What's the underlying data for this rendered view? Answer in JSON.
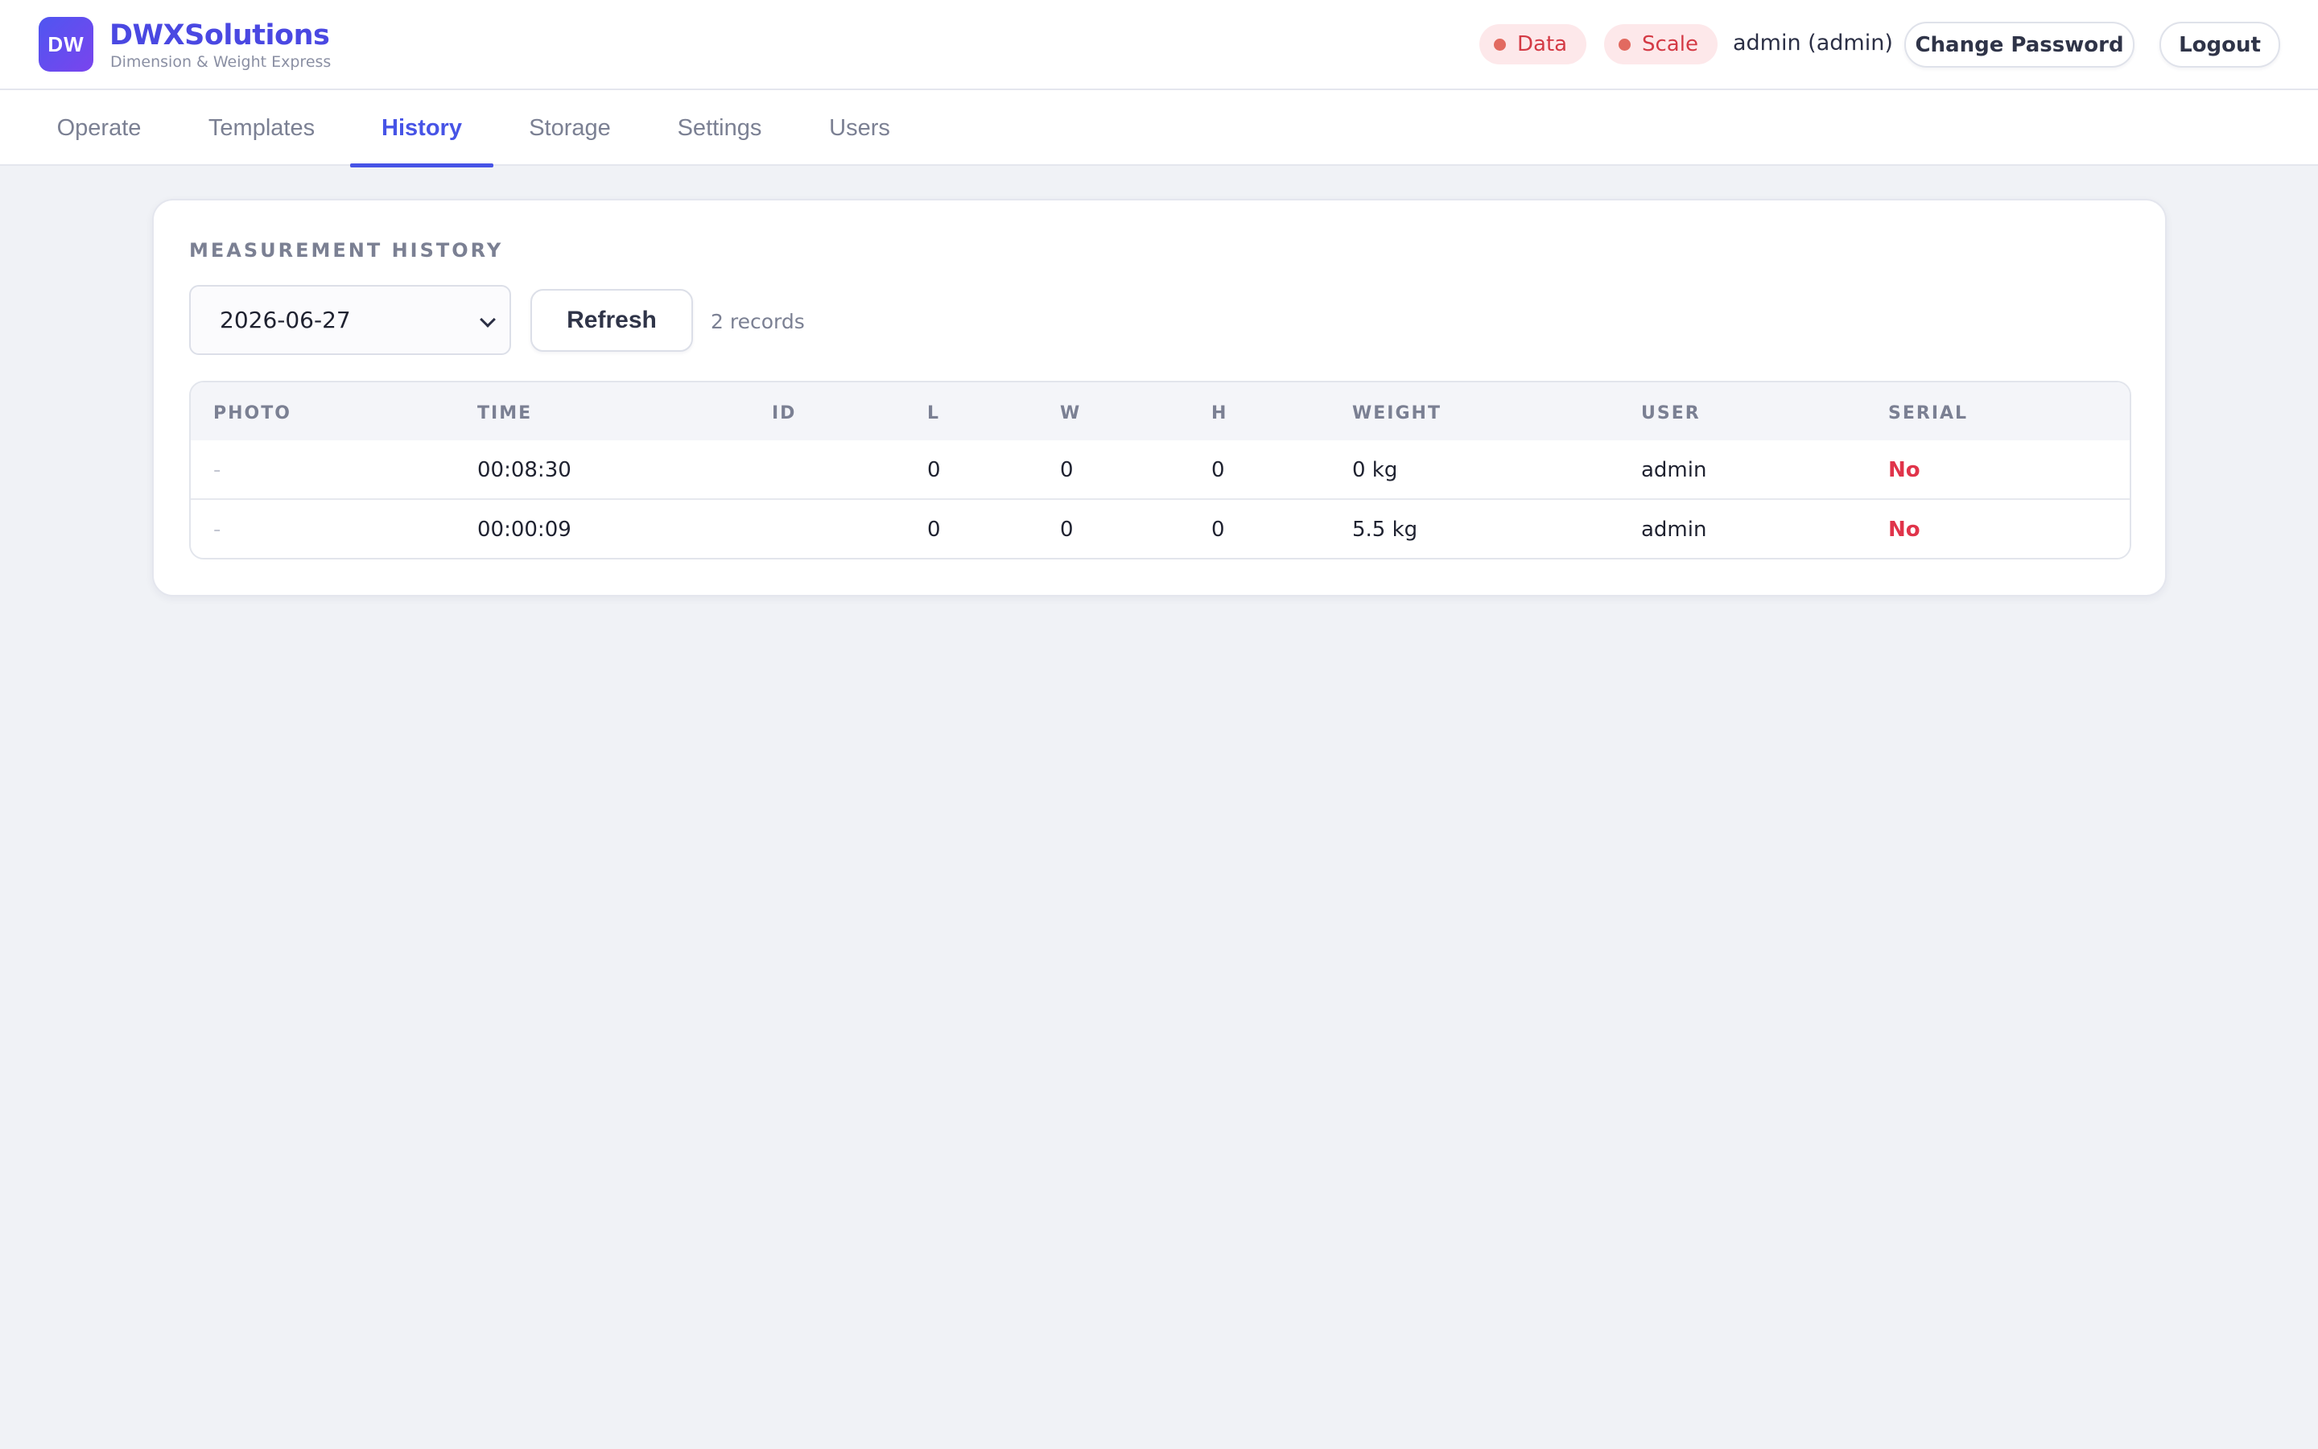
{
  "header": {
    "logo_initials": "DW",
    "brand_name": "DWXSolutions",
    "brand_subtitle": "Dimension & Weight Express",
    "status_pills": [
      {
        "label": "Data",
        "dot_color": "#e26a60"
      },
      {
        "label": "Scale",
        "dot_color": "#e26a60"
      }
    ],
    "user_label": "admin (admin)",
    "change_password_label": "Change Password",
    "logout_label": "Logout"
  },
  "tabs": [
    {
      "label": "Operate",
      "active": false
    },
    {
      "label": "Templates",
      "active": false
    },
    {
      "label": "History",
      "active": true
    },
    {
      "label": "Storage",
      "active": false
    },
    {
      "label": "Settings",
      "active": false
    },
    {
      "label": "Users",
      "active": false
    }
  ],
  "history": {
    "title": "MEASUREMENT HISTORY",
    "date_select": {
      "value": "2026-06-27"
    },
    "refresh_label": "Refresh",
    "record_count": "2 records",
    "columns": [
      "PHOTO",
      "TIME",
      "ID",
      "L",
      "W",
      "H",
      "WEIGHT",
      "USER",
      "SERIAL"
    ],
    "rows": [
      {
        "photo": "-",
        "time": "00:08:30",
        "id": "",
        "l": "0",
        "w": "0",
        "h": "0",
        "weight": "0 kg",
        "user": "admin",
        "serial": "No"
      },
      {
        "photo": "-",
        "time": "00:00:09",
        "id": "",
        "l": "0",
        "w": "0",
        "h": "0",
        "weight": "5.5 kg",
        "user": "admin",
        "serial": "No"
      }
    ]
  },
  "colors": {
    "accent": "#4754e6",
    "brand": "#4a48e2",
    "serial_no": "#e0344a",
    "status_pill_bg": "#fde8ea",
    "status_pill_text": "#d43a45"
  }
}
